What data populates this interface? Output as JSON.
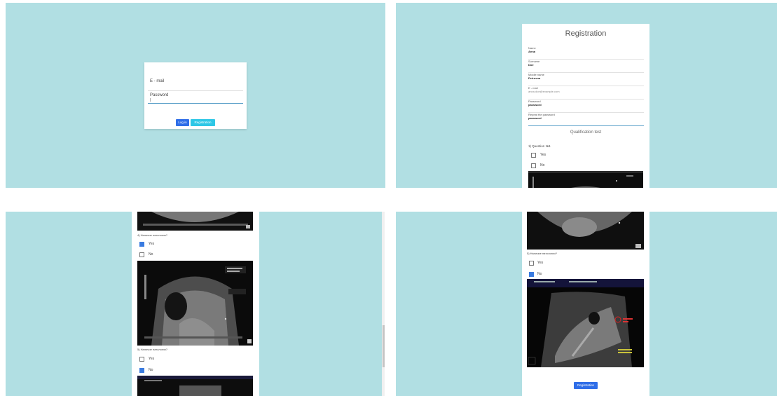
{
  "login": {
    "email_label": "E - mail",
    "password_label": "Password",
    "login_button": "Log in",
    "registration_button": "Registration"
  },
  "registration": {
    "title": "Registration",
    "fields": [
      {
        "label": "Name",
        "value": "Anna"
      },
      {
        "label": "Surname",
        "value": "Doe"
      },
      {
        "label": "Middle name",
        "value": "Petrovna"
      },
      {
        "label": "E - mail",
        "value": "anna.doe@example.com"
      },
      {
        "label": "Password",
        "value": "password"
      },
      {
        "label": "Repeat the password",
        "value": "password"
      }
    ],
    "qualification_title": "Qualification test",
    "question1": "1) Question №1",
    "yes": "Yes",
    "no": "No"
  },
  "panel3": {
    "question_a": "4) Наличие патологии?",
    "question_b": "5) Наличие патологии?",
    "yes": "Yes",
    "no": "No",
    "q_a_selected": "Yes",
    "q_b_selected": "No"
  },
  "panel4": {
    "question": "5) Наличие патологии?",
    "yes": "Yes",
    "no": "No",
    "selected": "No",
    "registration_button": "Registration"
  },
  "colors": {
    "background": "#b1dfe3",
    "primary_button": "#2f6ee8",
    "secondary_button": "#2ec7e6",
    "checkbox_checked": "#3a7be0"
  }
}
